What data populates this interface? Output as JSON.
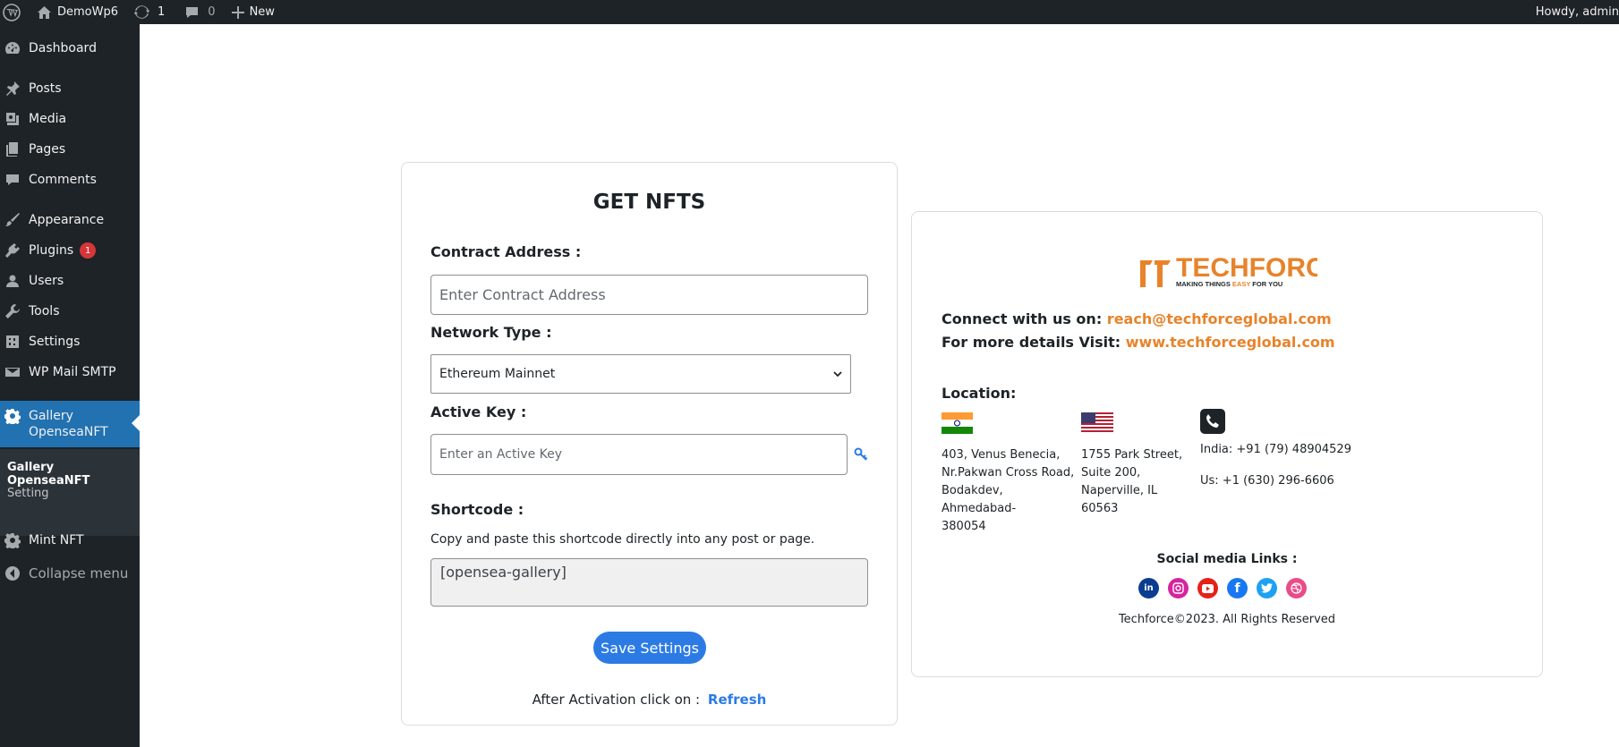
{
  "adminbar": {
    "site_name": "DemoWp6",
    "updates_count": "1",
    "comments_count": "0",
    "new_label": "New",
    "howdy": "Howdy, admin"
  },
  "sidebar": {
    "items": [
      {
        "label": "Dashboard",
        "icon": "dashboard-icon"
      },
      {
        "label": "Posts",
        "icon": "pin-icon"
      },
      {
        "label": "Media",
        "icon": "media-icon"
      },
      {
        "label": "Pages",
        "icon": "pages-icon"
      },
      {
        "label": "Comments",
        "icon": "comment-icon"
      },
      {
        "label": "Appearance",
        "icon": "brush-icon"
      },
      {
        "label": "Plugins",
        "icon": "plugin-icon",
        "badge": "1"
      },
      {
        "label": "Users",
        "icon": "user-icon"
      },
      {
        "label": "Tools",
        "icon": "wrench-icon"
      },
      {
        "label": "Settings",
        "icon": "settings-icon"
      },
      {
        "label": "WP Mail SMTP",
        "icon": "mail-icon"
      },
      {
        "label": "Gallery OpenseaNFT",
        "icon": "gear-icon"
      },
      {
        "label": "Mint NFT",
        "icon": "gear-icon"
      },
      {
        "label": "Collapse menu",
        "icon": "collapse-icon"
      }
    ],
    "submenu": [
      "Gallery OpenseaNFT",
      "Setting"
    ]
  },
  "form": {
    "title": "GET NFTS",
    "contract_label": "Contract Address :",
    "contract_placeholder": "Enter Contract Address",
    "network_label": "Network Type :",
    "network_value": "Ethereum Mainnet",
    "active_key_label": "Active Key :",
    "active_key_placeholder": "Enter an Active Key",
    "shortcode_label": "Shortcode :",
    "shortcode_desc": "Copy and paste this shortcode directly into any post or page.",
    "shortcode_value": "[opensea-gallery]",
    "save_label": "Save Settings",
    "activation_text": "After Activation click on :",
    "refresh_label": "Refresh"
  },
  "company": {
    "logo_text": "TECHFORCE",
    "logo_tagline_a": "MAKING THINGS ",
    "logo_tagline_b": "EASY",
    "logo_tagline_c": " FOR YOU",
    "connect_label": "Connect with us on:",
    "email": "reach@techforceglobal.com",
    "visit_label": "For more details Visit:",
    "website": "www.techforceglobal.com",
    "location_label": "Location:",
    "india_address": [
      "403, Venus Benecia,",
      "Nr.Pakwan Cross Road,",
      "Bodakdev, Ahmedabad-",
      "380054"
    ],
    "us_address": [
      "1755 Park Street,",
      "Suite 200,",
      "Naperville, IL 60563"
    ],
    "phone_india": "India: +91 (79) 48904529",
    "phone_us": "Us: +1 (630) 296-6606",
    "social_label": "Social media Links :",
    "social": [
      {
        "name": "linkedin",
        "color": "#0a3d8f"
      },
      {
        "name": "instagram",
        "color": "#d6249f"
      },
      {
        "name": "youtube",
        "color": "#e62117"
      },
      {
        "name": "facebook",
        "color": "#1877f2"
      },
      {
        "name": "twitter",
        "color": "#1da1f2"
      },
      {
        "name": "dribbble",
        "color": "#ea4c89"
      }
    ],
    "copyright": "Techforce©2023. All Rights Reserved"
  },
  "colors": {
    "accent": "#2271b1",
    "brand_orange": "#e8832a",
    "button_blue": "#2c7be5"
  }
}
